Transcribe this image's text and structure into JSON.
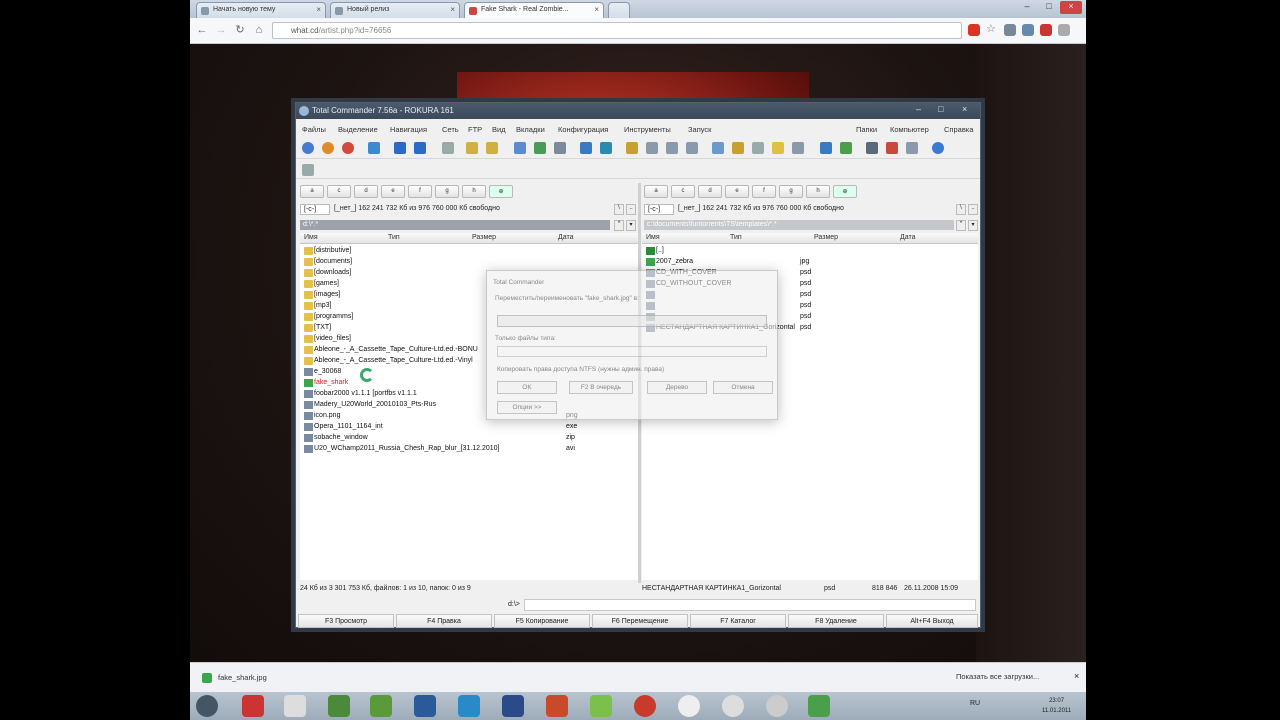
{
  "browser": {
    "tabs": [
      {
        "label": "Начать новую тему",
        "active": false
      },
      {
        "label": "Новый релиз",
        "active": false
      },
      {
        "label": "Fake Shark - Real Zombie...",
        "active": true
      }
    ],
    "url_host": "what.cd",
    "url_path": "/artist.php?id=76656"
  },
  "tc": {
    "title": "Total Commander 7.56a - ROKURA 161",
    "menu_left": [
      "Файлы",
      "Выделение",
      "Навигация",
      "Сеть",
      "FTP",
      "Вид",
      "Вкладки",
      "Конфигурация",
      "Инструменты",
      "Запуск"
    ],
    "menu_right": [
      "Папки",
      "Компьютер",
      "Справка"
    ],
    "left": {
      "disk_dd": "[-c-]",
      "disk_info": "[_нет_] 162 241 732 Кб из 976 760 000 Кб свободно",
      "path": "d:\\*.*",
      "columns": [
        "Имя",
        "Тип",
        "Размер",
        "Дата"
      ],
      "rows": [
        {
          "name": "[distributive]",
          "ext": "",
          "type": "folder"
        },
        {
          "name": "[documents]",
          "ext": "",
          "type": "folder"
        },
        {
          "name": "[downloads]",
          "ext": "",
          "type": "folder"
        },
        {
          "name": "[games]",
          "ext": "",
          "type": "folder"
        },
        {
          "name": "[images]",
          "ext": "",
          "type": "folder"
        },
        {
          "name": "[mp3]",
          "ext": "",
          "type": "folder"
        },
        {
          "name": "[programms]",
          "ext": "",
          "type": "folder"
        },
        {
          "name": "[TXT]",
          "ext": "",
          "type": "folder"
        },
        {
          "name": "[video_files]",
          "ext": "",
          "type": "folder"
        },
        {
          "name": "Ableone_-_A_Cassette_Tape_Culture-Ltd.ed.-BONU",
          "ext": "",
          "type": "folder"
        },
        {
          "name": "Ableone_-_A_Cassette_Tape_Culture-Ltd.ed.-Vinyl",
          "ext": "",
          "type": "folder"
        },
        {
          "name": "e_30068",
          "ext": "",
          "type": "file"
        },
        {
          "name": "fake_shark",
          "ext": "",
          "type": "image"
        },
        {
          "name": "foobar2000 v1.1.1 [portfbs v1.1.1",
          "ext": "",
          "type": "file"
        },
        {
          "name": "Madery_U20World_20010103_Pts-Rus",
          "ext": "",
          "type": "file"
        },
        {
          "name": "icon.png",
          "ext": "png",
          "type": "file"
        },
        {
          "name": "Opera_1101_1164_int",
          "ext": "exe",
          "type": "file"
        },
        {
          "name": "sobache_window",
          "ext": "zip",
          "type": "file"
        },
        {
          "name": "U20_WChamp2011_Russia_Chesh_Rap_blur_[31.12.2010]",
          "ext": "avi",
          "type": "file"
        }
      ],
      "status": "24 Кб из 3 301 753 Кб, файлов: 1 из 10, папок: 0 из 9"
    },
    "right": {
      "disk_dd": "[-c-]",
      "disk_info": "[_нет_] 162 241 732 Кб из 976 760 000 Кб свободно",
      "path": "c:\\documents\\funtorrents\\TS\\templates\\*.*",
      "columns": [
        "Имя",
        "Тип",
        "Размер",
        "Дата"
      ],
      "rows": [
        {
          "name": "[..]",
          "ext": "",
          "type": "up"
        },
        {
          "name": "2007_zebra",
          "ext": "jpg",
          "type": "image"
        },
        {
          "name": "CD_WITH_COVER",
          "ext": "psd",
          "type": "file"
        },
        {
          "name": "CD_WITHOUT_COVER",
          "ext": "psd",
          "type": "file"
        },
        {
          "name": "",
          "ext": "psd",
          "type": "file"
        },
        {
          "name": "",
          "ext": "psd",
          "type": "file"
        },
        {
          "name": "",
          "ext": "psd",
          "type": "file"
        },
        {
          "name": "НЕСТАНДАРТНАЯ КАРТИНКА1_Gorizontal",
          "ext": "psd",
          "type": "file"
        }
      ],
      "status": "НЕСТАНДАРТНАЯ КАРТИНКА1_Gorizontal",
      "status_ext": "psd",
      "status_size": "818 846",
      "status_date": "26.11.2008 15:09"
    },
    "cmd_prompt": "d:\\>",
    "fkeys": [
      "F3 Просмотр",
      "F4 Правка",
      "F5 Копирование",
      "F6 Перемещение",
      "F7 Каталог",
      "F8 Удаление",
      "Alt+F4 Выход"
    ]
  },
  "dialog": {
    "title": "Total Commander",
    "label": "Переместить/переименовать \"fake_shark.jpg\" в:",
    "only_types_label": "Только файлы типа:",
    "checkbox": "Копировать права доступа NTFS (нужны админ. права)",
    "buttons": [
      "OK",
      "F2 В очередь",
      "Дерево",
      "Отмена"
    ],
    "options": "Опции >>"
  },
  "downloads": {
    "item": "fake_shark.jpg",
    "show_all": "Показать все загрузки..."
  },
  "taskbar": {
    "lang": "RU",
    "time": "23:07",
    "date": "11.01.2011"
  }
}
